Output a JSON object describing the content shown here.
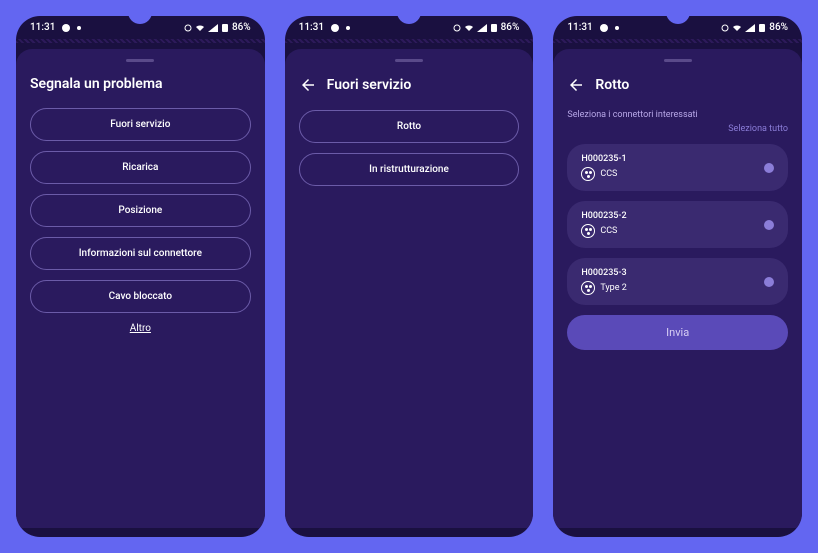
{
  "status": {
    "time": "11:31",
    "battery": "86%"
  },
  "screen1": {
    "title": "Segnala un problema",
    "options": [
      "Fuori servizio",
      "Ricarica",
      "Posizione",
      "Informazioni sul connettore",
      "Cavo bloccato"
    ],
    "other": "Altro"
  },
  "screen2": {
    "title": "Fuori servizio",
    "options": [
      "Rotto",
      "In ristrutturazione"
    ]
  },
  "screen3": {
    "title": "Rotto",
    "subtitle": "Seleziona i connettori interessati",
    "select_all": "Seleziona tutto",
    "connectors": [
      {
        "id": "H000235-1",
        "type": "CCS"
      },
      {
        "id": "H000235-2",
        "type": "CCS"
      },
      {
        "id": "H000235-3",
        "type": "Type 2"
      }
    ],
    "submit": "Invia"
  }
}
